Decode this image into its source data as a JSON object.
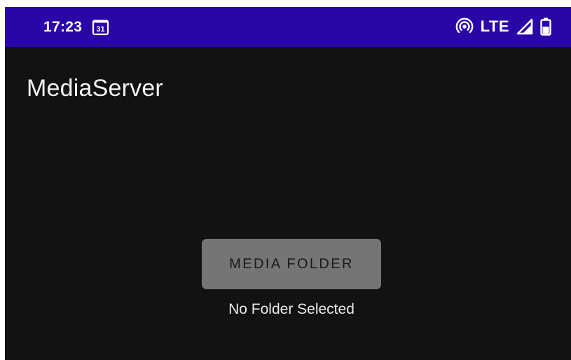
{
  "status_bar": {
    "time": "17:23",
    "calendar_day": "31",
    "network_type": "LTE",
    "background_color": "#2a05a8",
    "icons": [
      "calendar-icon",
      "hotspot-icon",
      "signal-icon",
      "battery-icon"
    ]
  },
  "app": {
    "title": "MediaServer",
    "background_color": "#121212"
  },
  "main": {
    "media_folder_button_label": "MEDIA FOLDER",
    "button_color": "#757575",
    "folder_status": "No Folder Selected"
  }
}
